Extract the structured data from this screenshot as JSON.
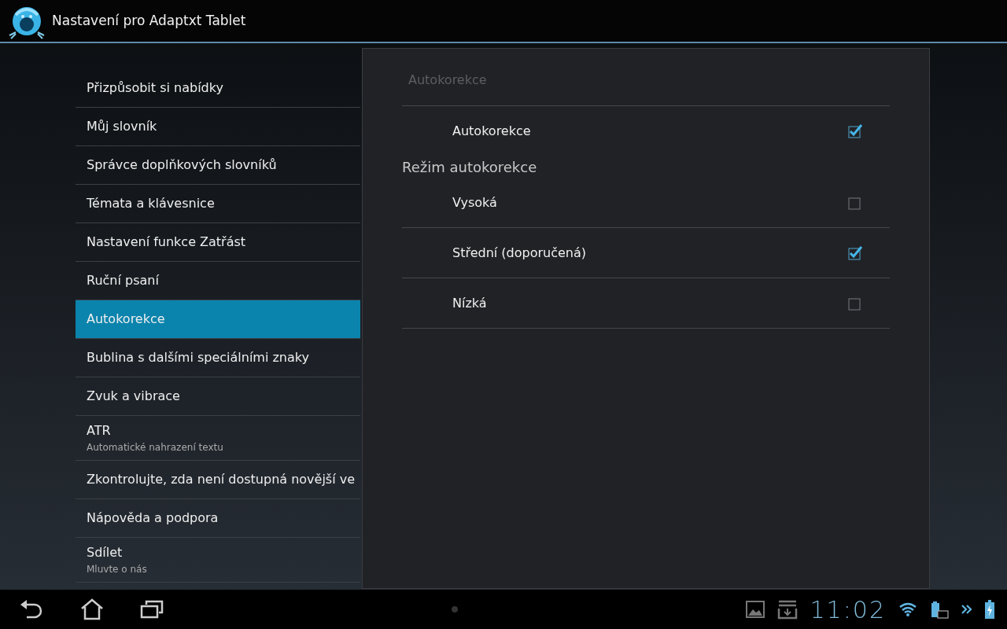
{
  "app_bar": {
    "title": "Nastavení pro Adaptxt Tablet"
  },
  "menu": [
    {
      "label": "Přizpůsobit si nabídky",
      "selected": false
    },
    {
      "label": "Můj slovník",
      "selected": false
    },
    {
      "label": "Správce doplňkových slovníků",
      "selected": false
    },
    {
      "label": "Témata a klávesnice",
      "selected": false
    },
    {
      "label": "Nastavení funkce Zatřást",
      "selected": false
    },
    {
      "label": "Ruční psaní",
      "selected": false
    },
    {
      "label": "Autokorekce",
      "selected": true
    },
    {
      "label": "Bublina s dalšími speciálními znaky",
      "selected": false
    },
    {
      "label": "Zvuk a vibrace",
      "selected": false
    },
    {
      "label": "ATR",
      "summary": "Automatické nahrazení textu",
      "selected": false
    },
    {
      "label": "Zkontrolujte, zda není dostupná novější ve",
      "selected": false
    },
    {
      "label": "Nápověda a podpora",
      "selected": false
    },
    {
      "label": "Sdílet",
      "summary": "Mluvte o nás",
      "selected": false
    }
  ],
  "detail": {
    "title": "Autokorekce",
    "items": [
      {
        "kind": "checkbox",
        "label": "Autokorekce",
        "checked": true
      },
      {
        "kind": "category",
        "label": "Režim autokorekce"
      },
      {
        "kind": "checkbox",
        "label": "Vysoká",
        "checked": false
      },
      {
        "kind": "checkbox",
        "label": "Střední (doporučená)",
        "checked": true
      },
      {
        "kind": "checkbox",
        "label": "Nízká",
        "checked": false
      }
    ]
  },
  "status_bar": {
    "time": "11:02"
  }
}
